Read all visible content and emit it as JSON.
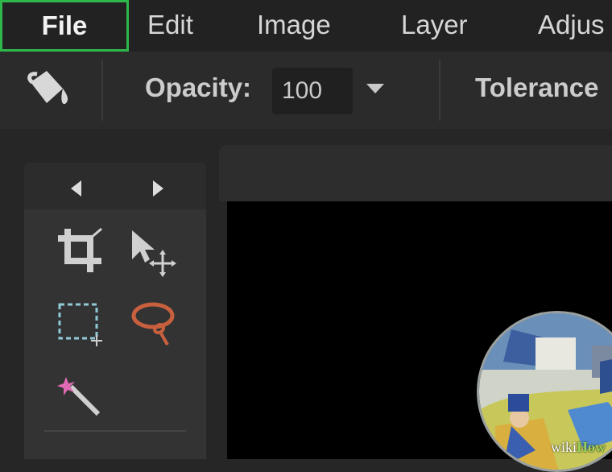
{
  "menubar": {
    "items": [
      {
        "label": "File",
        "active": true
      },
      {
        "label": "Edit"
      },
      {
        "label": "Image"
      },
      {
        "label": "Layer"
      },
      {
        "label": "Adjus"
      }
    ]
  },
  "options": {
    "tool_icon": "paint-bucket-icon",
    "opacity_label": "Opacity:",
    "opacity_value": "100",
    "tolerance_label": "Tolerance"
  },
  "toolbox": {
    "nav": [
      "triangle-left-icon",
      "triangle-right-icon"
    ],
    "tools": [
      "crop-icon",
      "move-icon",
      "marquee-select-icon",
      "lasso-icon",
      "magic-wand-icon"
    ]
  },
  "watermark": {
    "prefix": "wiki",
    "suffix": "How"
  },
  "colors": {
    "active_outline": "#2fb84a",
    "lasso": "#c8603e",
    "marquee": "#8fc9d8",
    "wand": "#e06bb4"
  }
}
